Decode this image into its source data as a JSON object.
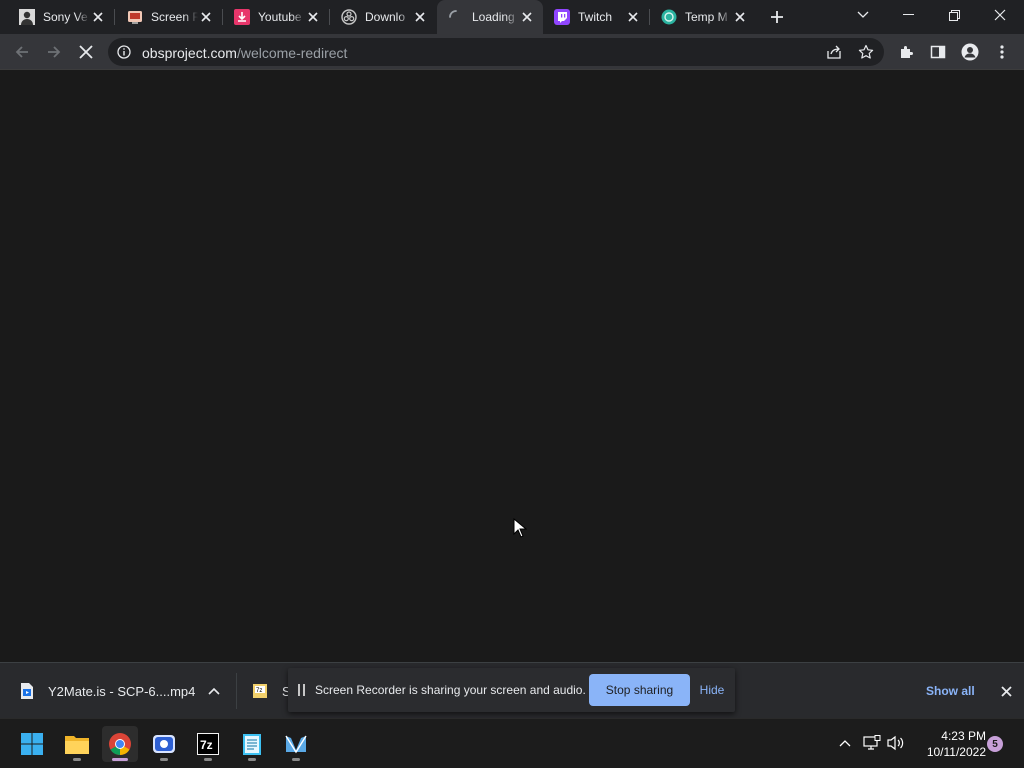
{
  "browser": {
    "tabs": [
      {
        "title": "Sony Ve",
        "favicon": "profile-photo-icon",
        "active": false
      },
      {
        "title": "Screen R",
        "favicon": "screen-recorder-icon",
        "active": false
      },
      {
        "title": "Youtube",
        "favicon": "download-arrow-icon",
        "active": false
      },
      {
        "title": "Downlo",
        "favicon": "obs-icon",
        "active": false
      },
      {
        "title": "Loading",
        "favicon": "loading-spinner-icon",
        "active": true
      },
      {
        "title": "Twitch",
        "favicon": "twitch-icon",
        "active": false
      },
      {
        "title": "Temp M",
        "favicon": "temp-mail-icon",
        "active": false
      }
    ],
    "address_bar": {
      "host": "obsproject.com",
      "path": "/welcome-redirect"
    }
  },
  "download_shelf": {
    "items": [
      {
        "name": "Y2Mate.is - SCP-6....mp4",
        "icon": "video-file-icon"
      },
      {
        "name": "S",
        "icon": "archive-file-icon"
      }
    ],
    "show_all_label": "Show all"
  },
  "share_notification": {
    "message": "Screen Recorder is sharing your screen and audio.",
    "stop_label": "Stop sharing",
    "hide_label": "Hide"
  },
  "taskbar": {
    "apps": [
      "start-icon",
      "file-explorer-icon",
      "chrome-icon",
      "screen-recorder-app-icon",
      "7zip-icon",
      "notepad-icon",
      "vscode-like-icon"
    ],
    "time": "4:23 PM",
    "date": "10/11/2022",
    "notification_count": "5"
  },
  "colors": {
    "accent": "#8ab4f8",
    "tabstrip": "#202124",
    "toolbar": "#35363a",
    "page": "#1a1a1a"
  }
}
